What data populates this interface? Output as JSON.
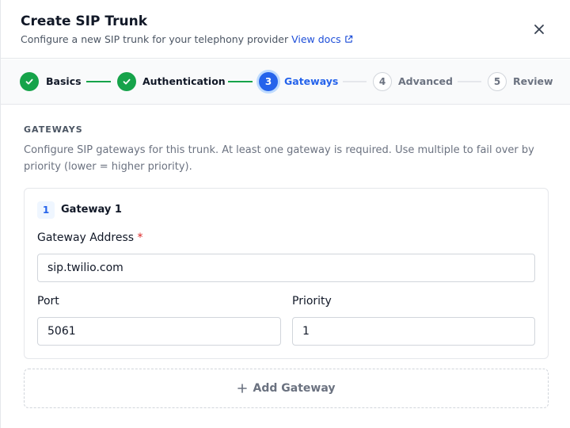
{
  "dialog": {
    "title": "Create SIP Trunk",
    "subtitle": "Configure a new SIP trunk for your telephony provider",
    "docs_link": "View docs"
  },
  "steps": [
    {
      "number": "1",
      "label": "Basics",
      "state": "complete"
    },
    {
      "number": "2",
      "label": "Authentication",
      "state": "complete"
    },
    {
      "number": "3",
      "label": "Gateways",
      "state": "active"
    },
    {
      "number": "4",
      "label": "Advanced",
      "state": "pending"
    },
    {
      "number": "5",
      "label": "Review",
      "state": "pending"
    }
  ],
  "section": {
    "heading": "GATEWAYS",
    "description": "Configure SIP gateways for this trunk. At least one gateway is required. Use multiple to fail over by priority (lower = higher priority)."
  },
  "gateways": [
    {
      "index": "1",
      "title": "Gateway 1",
      "address_label": "Gateway Address",
      "address_required_marker": "*",
      "address_value": "sip.twilio.com",
      "port_label": "Port",
      "port_value": "5061",
      "priority_label": "Priority",
      "priority_value": "1"
    }
  ],
  "add_gateway_label": "Add Gateway",
  "colors": {
    "complete": "#16a34a",
    "active": "#2563eb",
    "link": "#1d4ed8",
    "required": "#dc2626"
  },
  "icons": {
    "close": "close-icon",
    "external_link": "external-link-icon",
    "check": "check-icon",
    "plus": "plus-icon"
  }
}
